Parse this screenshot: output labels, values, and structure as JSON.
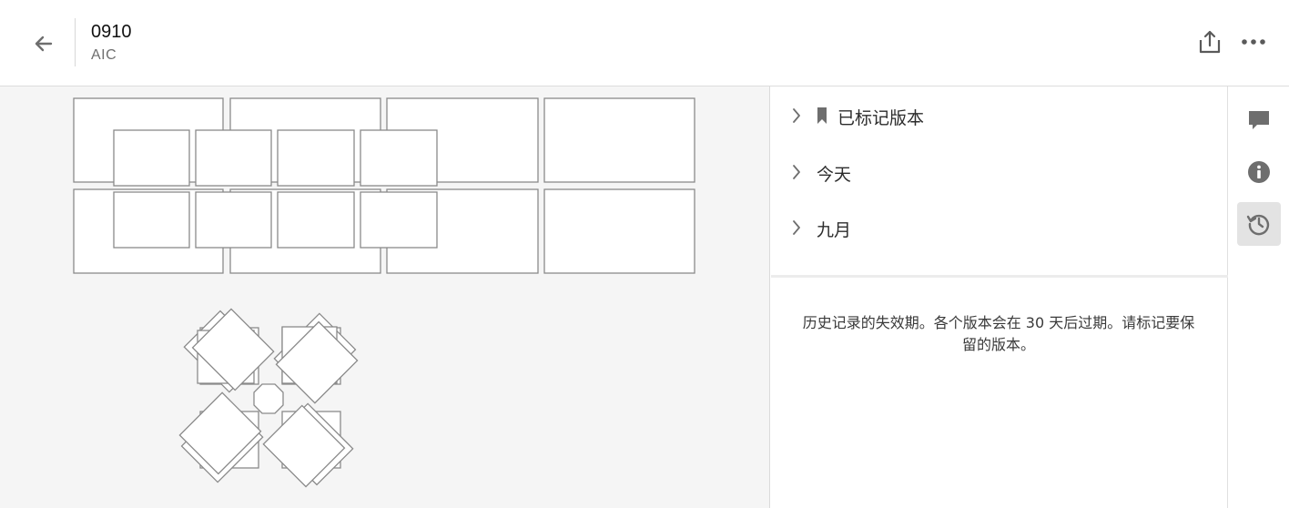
{
  "header": {
    "title": "0910",
    "subtitle": "AIC",
    "icons": {
      "back": "arrow-left-icon",
      "share": "share-icon",
      "more": "more-horizontal-icon"
    }
  },
  "version_panel": {
    "groups": [
      {
        "label": "已标记版本",
        "icon": "bookmark-icon",
        "expanded": false
      },
      {
        "label": "今天",
        "expanded": false
      },
      {
        "label": "九月",
        "expanded": false
      }
    ],
    "expiry_note": "历史记录的失效期。各个版本会在 30 天后过期。请标记要保留的版本。"
  },
  "side_rail": {
    "items": [
      {
        "icon": "comment-icon",
        "active": false
      },
      {
        "icon": "info-icon",
        "active": false
      },
      {
        "icon": "version-history-icon",
        "active": true
      }
    ],
    "active_color": "#e3e3e3"
  },
  "colors": {
    "canvas_bg": "#f5f5f5",
    "shape_stroke": "#8a8a8a",
    "icon": "#6e6e6e"
  }
}
